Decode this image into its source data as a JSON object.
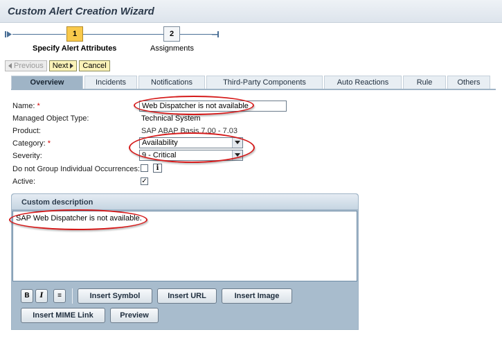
{
  "window": {
    "title": "Custom Alert Creation Wizard"
  },
  "roadmap": {
    "steps": [
      {
        "number": "1",
        "label": "Specify Alert Attributes",
        "active": true
      },
      {
        "number": "2",
        "label": "Assignments",
        "active": false
      }
    ]
  },
  "nav": {
    "previous": "Previous",
    "next": "Next",
    "cancel": "Cancel"
  },
  "tabs": [
    "Overview",
    "Incidents",
    "Notifications",
    "Third-Party Components",
    "Auto Reactions",
    "Rule",
    "Others"
  ],
  "form": {
    "name_label": "Name:",
    "name_value": "Web Dispatcher is not available",
    "mot_label": "Managed Object Type:",
    "mot_value": "Technical System",
    "product_label": "Product:",
    "product_value": "SAP ABAP Basis 7.00 - 7.03",
    "category_label": "Category:",
    "category_value": "Availability",
    "severity_label": "Severity:",
    "severity_value": "9 - Critical",
    "nogroup_label": "Do not Group Individual Occurrences:",
    "nogroup_checked": false,
    "active_label": "Active:",
    "active_checked": true,
    "required_marker": "*",
    "check_mark": "✓",
    "info_glyph": "i"
  },
  "description": {
    "title": "Custom description",
    "text": "SAP Web Dispatcher is not available.",
    "format_buttons": {
      "bold": "B",
      "italic": "I",
      "list": "≡"
    },
    "buttons": {
      "insert_symbol": "Insert Symbol",
      "insert_url": "Insert URL",
      "insert_image": "Insert Image",
      "insert_mime_link": "Insert MIME Link",
      "preview": "Preview"
    }
  },
  "colors": {
    "accent_yellow": "#f9c94b",
    "tab_active": "#9fb4c6",
    "highlight_red": "#d51a1a"
  }
}
